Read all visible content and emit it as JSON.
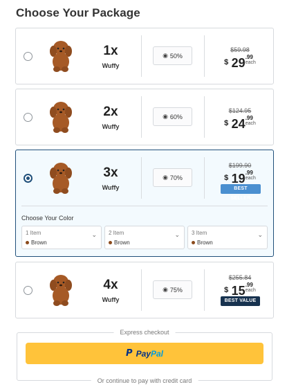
{
  "header": {
    "title": "Choose Your Package"
  },
  "packages": [
    {
      "qty": "1x",
      "brand": "Wuffy",
      "discount": "50%",
      "old_price": "$59.98",
      "currency": "$",
      "price_whole": "29",
      "price_cents": ".99",
      "each": "each",
      "tag": "",
      "selected": false
    },
    {
      "qty": "2x",
      "brand": "Wuffy",
      "discount": "60%",
      "old_price": "$124.95",
      "currency": "$",
      "price_whole": "24",
      "price_cents": ".99",
      "each": "each",
      "tag": "",
      "selected": false
    },
    {
      "qty": "3x",
      "brand": "Wuffy",
      "discount": "70%",
      "old_price": "$199.90",
      "currency": "$",
      "price_whole": "19",
      "price_cents": ".99",
      "each": "each",
      "tag": "BEST SELLER",
      "selected": true
    },
    {
      "qty": "4x",
      "brand": "Wuffy",
      "discount": "75%",
      "old_price": "$255.84",
      "currency": "$",
      "price_whole": "15",
      "price_cents": ".99",
      "each": "each",
      "tag": "BEST VALUE",
      "selected": false
    }
  ],
  "color_picker": {
    "label": "Choose Your Color",
    "selects": [
      {
        "item": "1 Item",
        "value": "Brown"
      },
      {
        "item": "2 Item",
        "value": "Brown"
      },
      {
        "item": "3 Item",
        "value": "Brown"
      }
    ]
  },
  "checkout": {
    "express_label": "Express checkout",
    "paypal_label_a": "Pay",
    "paypal_label_b": "Pal",
    "continue_label": "Or continue to pay with credit card"
  },
  "colors": {
    "selected_border": "#1f4f7a",
    "best_seller": "#4a8fd0",
    "best_value": "#17324f",
    "paypal_yellow": "#ffc33a",
    "swatch_brown": "#8b4a1c"
  },
  "icons": {
    "discount": "tag-icon",
    "dropdown": "chevron-down-icon",
    "product": "poodle-plush-image",
    "paypal": "paypal-logo-icon"
  }
}
